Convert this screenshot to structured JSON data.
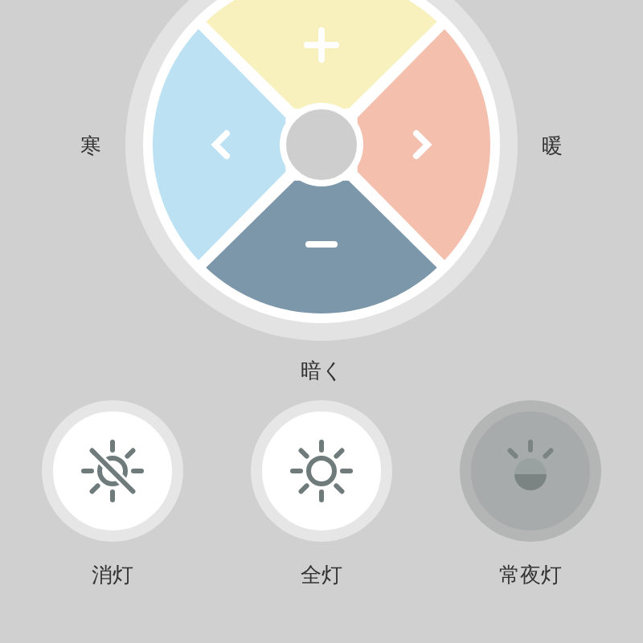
{
  "dial": {
    "segments": [
      {
        "kind": "plus",
        "color": "#f8f1bd"
      },
      {
        "kind": "right",
        "color": "#f5bfad"
      },
      {
        "kind": "minus",
        "color": "#7c97a9"
      },
      {
        "kind": "left",
        "color": "#bbe1f3"
      }
    ]
  },
  "side_labels": {
    "left": "寒",
    "right": "暖",
    "bottom": "暗く"
  },
  "modes": [
    {
      "kind": "off",
      "label": "消灯",
      "selected": false
    },
    {
      "kind": "full",
      "label": "全灯",
      "selected": false
    },
    {
      "kind": "night",
      "label": "常夜灯",
      "selected": true
    }
  ]
}
